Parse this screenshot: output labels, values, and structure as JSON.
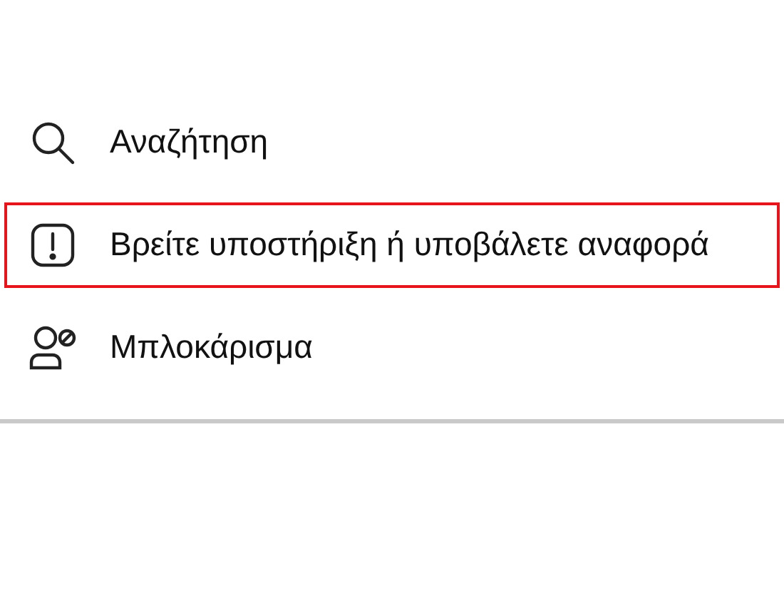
{
  "menu": {
    "items": [
      {
        "kind": "search",
        "label": "Αναζήτηση",
        "highlighted": false
      },
      {
        "kind": "report",
        "label": "Βρείτε υποστήριξη ή υποβάλετε αναφορά",
        "highlighted": true
      },
      {
        "kind": "block",
        "label": "Μπλοκάρισμα",
        "highlighted": false
      }
    ]
  }
}
